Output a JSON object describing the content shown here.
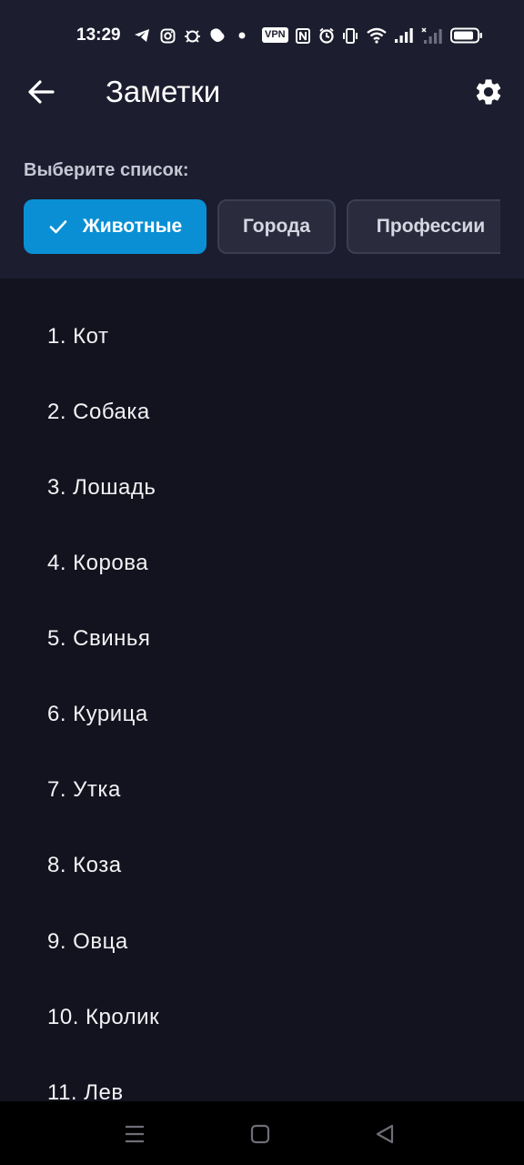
{
  "status_bar": {
    "time": "13:29",
    "vpn_label": "VPN",
    "icons": [
      "telegram-icon",
      "instagram-icon",
      "bug-icon",
      "app-icon",
      "dot-icon",
      "vpn-icon",
      "nfc-icon",
      "alarm-icon",
      "vibrate-icon",
      "wifi-icon",
      "signal-icon",
      "signal-icon",
      "battery-icon"
    ]
  },
  "appbar": {
    "title": "Заметки",
    "back_icon": "arrow-left-icon",
    "settings_icon": "gear-icon"
  },
  "selector": {
    "label": "Выберите список:",
    "chips": [
      {
        "label": "Животные",
        "selected": true
      },
      {
        "label": "Города",
        "selected": false
      },
      {
        "label": "Профессии",
        "selected": false
      }
    ]
  },
  "list": {
    "items": [
      "1. Кот",
      "2. Собака",
      "3. Лошадь",
      "4. Корова",
      "5. Свинья",
      "6. Курица",
      "7. Утка",
      "8. Коза",
      "9. Овца",
      "10. Кролик",
      "11. Лев"
    ]
  },
  "colors": {
    "accent": "#0a8fd4",
    "header_bg": "#1c1d2e",
    "list_bg": "#13131f"
  }
}
